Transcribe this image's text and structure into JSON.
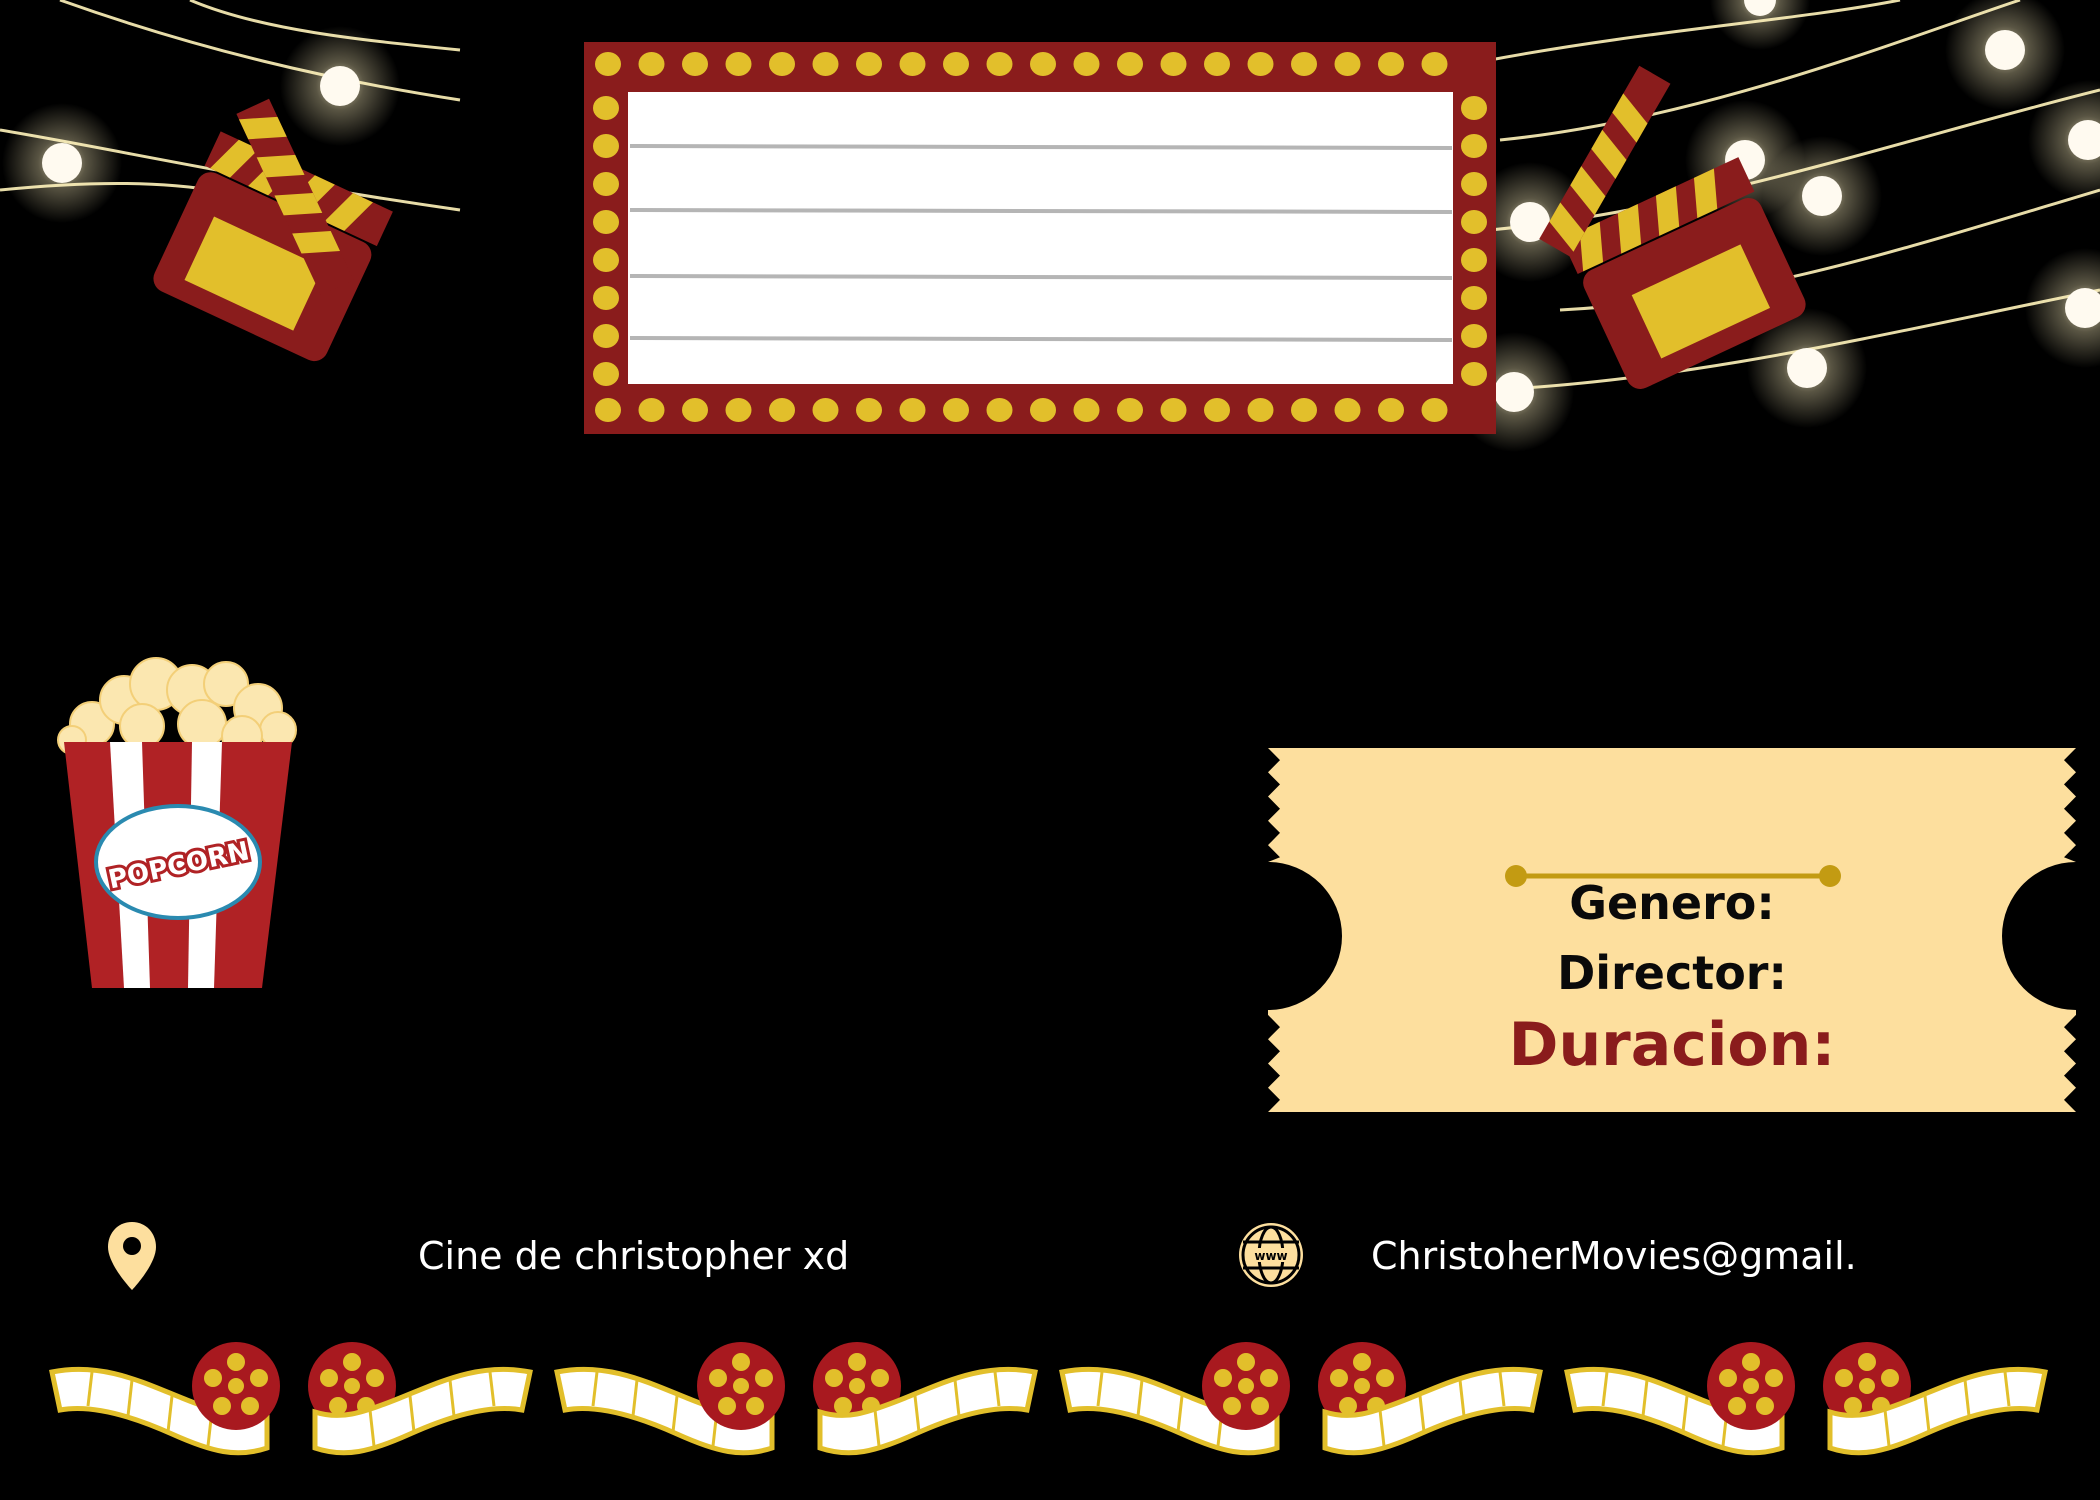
{
  "ticket": {
    "genre_label": "Genero:",
    "director_label": "Director:",
    "duration_label": "Duracion:"
  },
  "footer": {
    "address": "Cine de christopher xd",
    "email": "ChristoherMovies@gmail."
  },
  "icons": {
    "location": "location-pin-icon",
    "web": "globe-www-icon",
    "popcorn_label": "POPCORN",
    "www_label": "www"
  },
  "colors": {
    "background": "#000000",
    "brand_red": "#8a1c1c",
    "brand_gold": "#e2bf2b",
    "ticket": "#fddf9e",
    "light": "#fff6dc"
  }
}
